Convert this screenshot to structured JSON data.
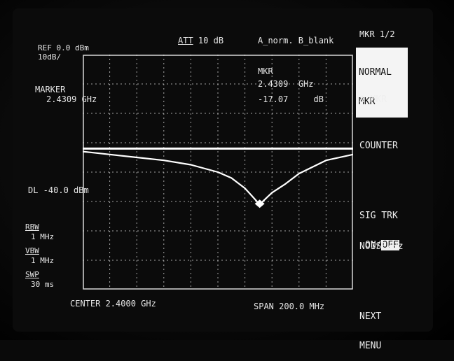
{
  "header": {
    "ref_level": "REF 0.0 dBm",
    "scale": "10dB/",
    "attenuation_label": "ATT",
    "attenuation_value": "10 dB",
    "trace_modes": "A_norm. B_blank"
  },
  "marker_panel": {
    "label": "MARKER",
    "freq": "2.4309 GHz"
  },
  "marker_readout": {
    "title": "MKR",
    "freq_value": "2.4309",
    "freq_unit": "GHz",
    "amp_value": "-17.07",
    "amp_unit": "dB"
  },
  "display_line": "DL -40.0 dBm",
  "settings": {
    "rbw_label": "RBW",
    "rbw_value": "1 MHz",
    "vbw_label": "VBW",
    "vbw_value": "1 MHz",
    "swp_label": "SWP",
    "swp_value": "30 ms"
  },
  "footer": {
    "center": "CENTER 2.4000 GHz",
    "span": "SPAN 200.0 MHz"
  },
  "softkeys": {
    "menu_title": "MKR 1/2",
    "normal_mkr_line1": "NORMAL",
    "normal_mkr_line2": "MKR",
    "delta_mkr": "Δ MKR",
    "counter": "COUNTER",
    "sig_trk_line1": "SIG TRK",
    "sig_trk_on": "ON/",
    "sig_trk_off": "OFF",
    "noise_hz": "NOISE/Hz",
    "next_line1": "NEXT",
    "next_line2": "MENU"
  },
  "colors": {
    "screen_bg": "#0b0b0b",
    "trace": "#ffffff",
    "grid": "#d8d8d8"
  },
  "chart_data": {
    "type": "line",
    "x_unit": "GHz",
    "x_range": [
      2.3,
      2.5
    ],
    "y_range_dB": [
      -80,
      0
    ],
    "reference_line_dB": -32,
    "marker": {
      "x": 2.4309,
      "y": -17.07
    },
    "trace": {
      "x": [
        2.3,
        2.32,
        2.34,
        2.36,
        2.38,
        2.4,
        2.41,
        2.42,
        2.425,
        2.4309,
        2.44,
        2.45,
        2.46,
        2.48,
        2.5
      ],
      "y": [
        -33,
        -34,
        -35,
        -36,
        -37.5,
        -40,
        -42,
        -45.5,
        -48,
        -51,
        -47,
        -44,
        -40.5,
        -36,
        -34
      ]
    }
  }
}
